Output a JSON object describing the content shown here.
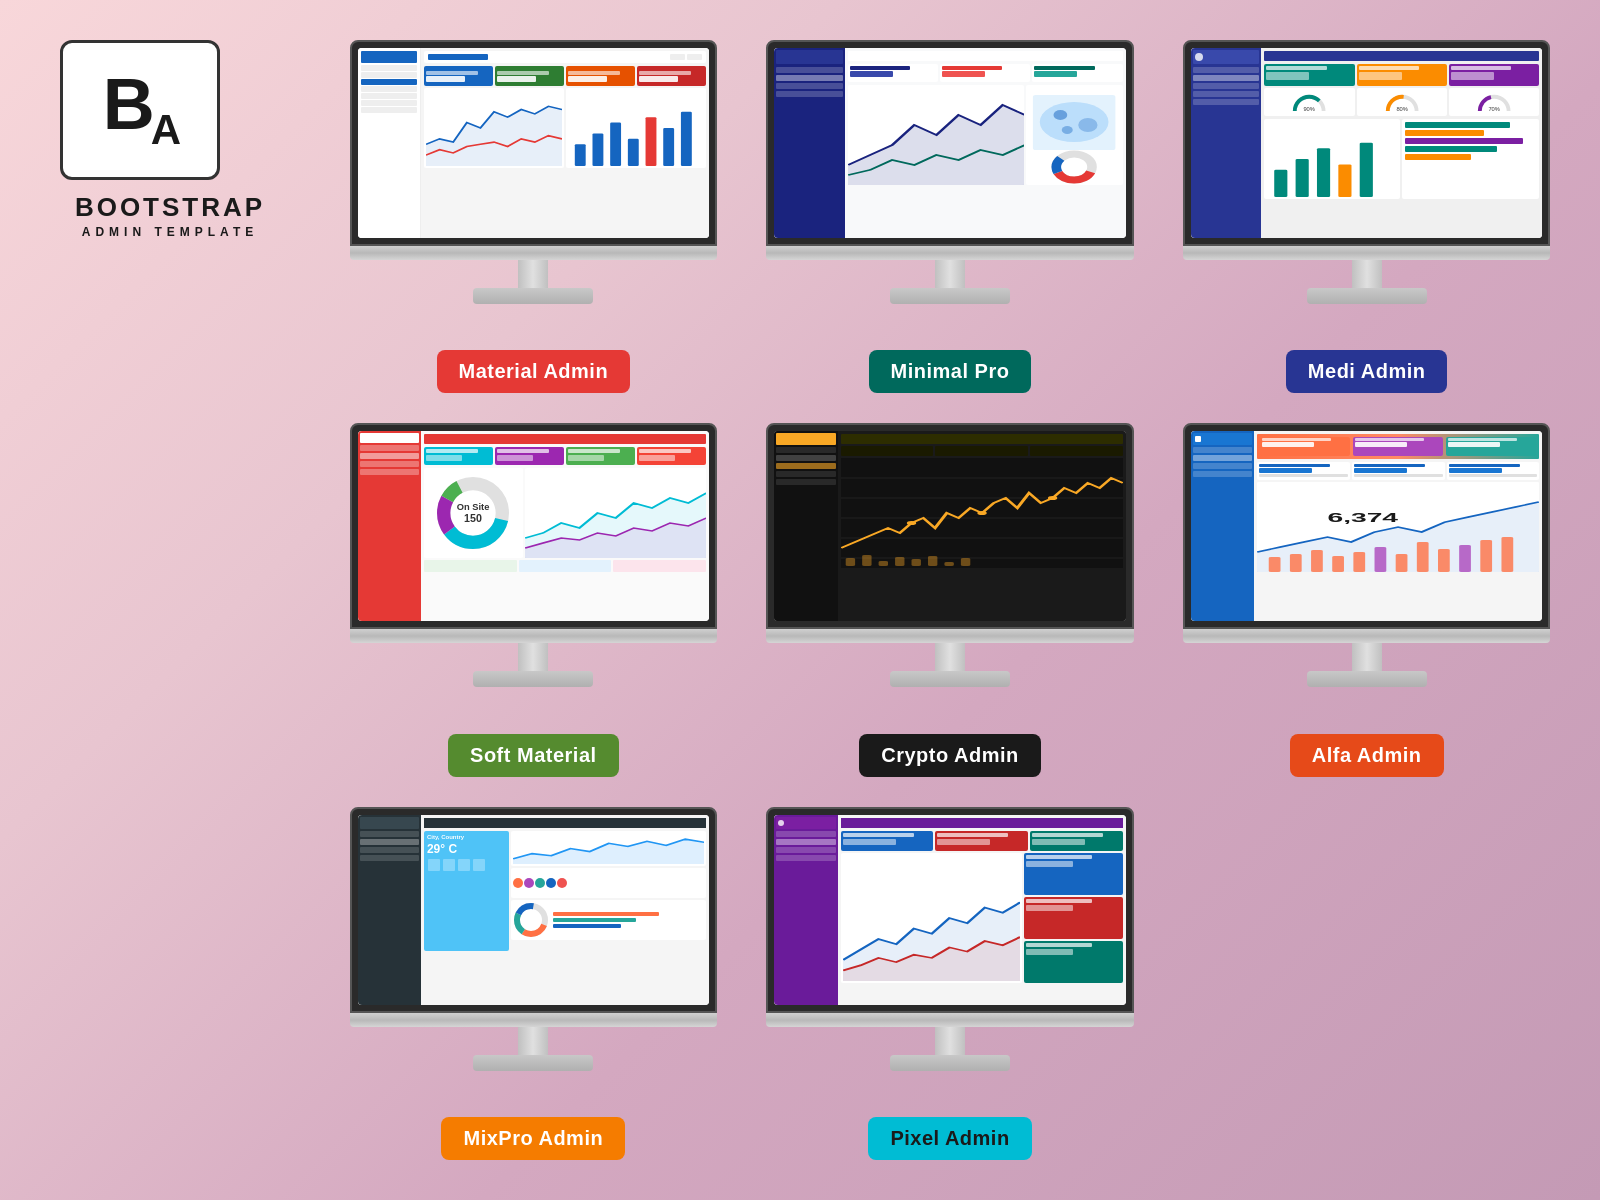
{
  "logo": {
    "letters": "BA",
    "title": "BOOTSTRAP",
    "subtitle": "ADMIN TEMPLATE"
  },
  "templates": [
    {
      "id": "material-admin",
      "label": "Material Admin",
      "badge_color": "#e53935",
      "position": "row1-col2"
    },
    {
      "id": "minimal-pro",
      "label": "Minimal Pro",
      "badge_color": "#00695c",
      "position": "row1-col3"
    },
    {
      "id": "medi-admin",
      "label": "Medi Admin",
      "badge_color": "#283593",
      "position": "row2-col1"
    },
    {
      "id": "soft-material",
      "label": "Soft Material",
      "badge_color": "#558b2f",
      "position": "row2-col2"
    },
    {
      "id": "crypto-admin",
      "label": "Crypto Admin",
      "badge_color": "#1a1a1a",
      "position": "row2-col3"
    },
    {
      "id": "alfa-admin",
      "label": "Alfa Admin",
      "badge_color": "#e64a19",
      "position": "row3-col1"
    },
    {
      "id": "mixpro-admin",
      "label": "MixPro Admin",
      "badge_color": "#f57c00",
      "position": "row3-col2"
    },
    {
      "id": "pixel-admin",
      "label": "Pixel Admin",
      "badge_color": "#00bcd4",
      "position": "row3-col3"
    }
  ]
}
